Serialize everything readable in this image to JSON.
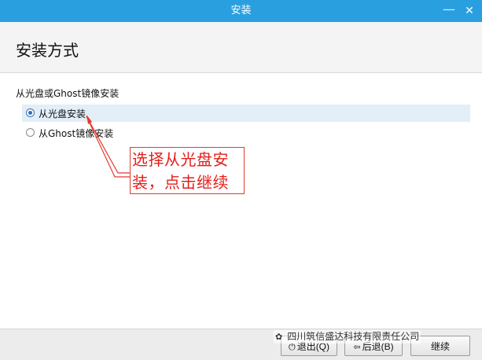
{
  "window": {
    "title": "安装",
    "minimize": "—",
    "close": "✕"
  },
  "header": {
    "heading": "安装方式"
  },
  "group": {
    "label": "从光盘或Ghost镜像安装"
  },
  "options": [
    {
      "label": "从光盘安装",
      "selected": true
    },
    {
      "label": "从Ghost镜像安装",
      "selected": false
    }
  ],
  "annotation": {
    "text": "选择从光盘安装，点击继续",
    "color": "#e3201a"
  },
  "footer": {
    "exit_label": "退出(Q)",
    "back_label": "后退(B)",
    "next_label": "继续"
  },
  "watermark": {
    "text": "四川筑信盛达科技有限责任公司"
  },
  "colors": {
    "titlebar": "#2a9fe0",
    "selected_row": "#e2eef8",
    "annotation": "#e3201a"
  },
  "icons": {
    "exit": "power-icon",
    "back": "back-arrow-icon",
    "watermark": "wechat-icon"
  }
}
